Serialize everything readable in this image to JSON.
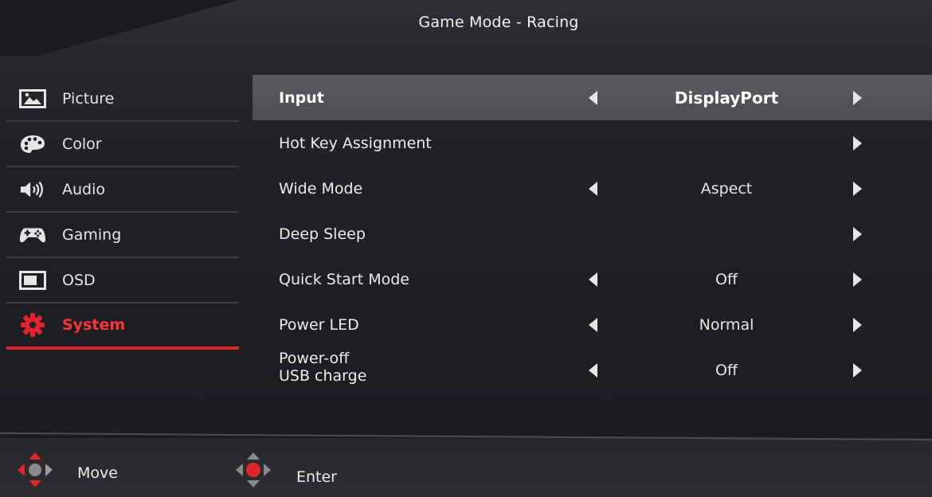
{
  "title": "Game Mode - Racing",
  "sidebar": {
    "items": [
      {
        "label": "Picture",
        "icon": "picture-icon",
        "active": false
      },
      {
        "label": "Color",
        "icon": "palette-icon",
        "active": false
      },
      {
        "label": "Audio",
        "icon": "speaker-icon",
        "active": false
      },
      {
        "label": "Gaming",
        "icon": "gamepad-icon",
        "active": false
      },
      {
        "label": "OSD",
        "icon": "osd-window-icon",
        "active": false
      },
      {
        "label": "System",
        "icon": "gear-icon",
        "active": true
      }
    ]
  },
  "settings": {
    "rows": [
      {
        "label": "Input",
        "value": "DisplayPort",
        "left_arrow": true,
        "right_arrow": true,
        "selected": true
      },
      {
        "label": "Hot Key Assignment",
        "value": "",
        "left_arrow": false,
        "right_arrow": true,
        "selected": false
      },
      {
        "label": "Wide Mode",
        "value": "Aspect",
        "left_arrow": true,
        "right_arrow": true,
        "selected": false
      },
      {
        "label": "Deep Sleep",
        "value": "",
        "left_arrow": false,
        "right_arrow": true,
        "selected": false
      },
      {
        "label": "Quick Start Mode",
        "value": "Off",
        "left_arrow": true,
        "right_arrow": true,
        "selected": false
      },
      {
        "label": "Power LED",
        "value": "Normal",
        "left_arrow": true,
        "right_arrow": true,
        "selected": false
      },
      {
        "label_line1": "Power-off",
        "label_line2": "USB charge",
        "value": "Off",
        "left_arrow": true,
        "right_arrow": true,
        "selected": false
      }
    ]
  },
  "footer": {
    "move_label": "Move",
    "enter_label": "Enter",
    "move_icon": "dpad-move-icon",
    "enter_icon": "dpad-enter-icon"
  },
  "colors": {
    "accent": "#e3232b",
    "active_text": "#ff3434",
    "selected_row": "#55575b"
  }
}
